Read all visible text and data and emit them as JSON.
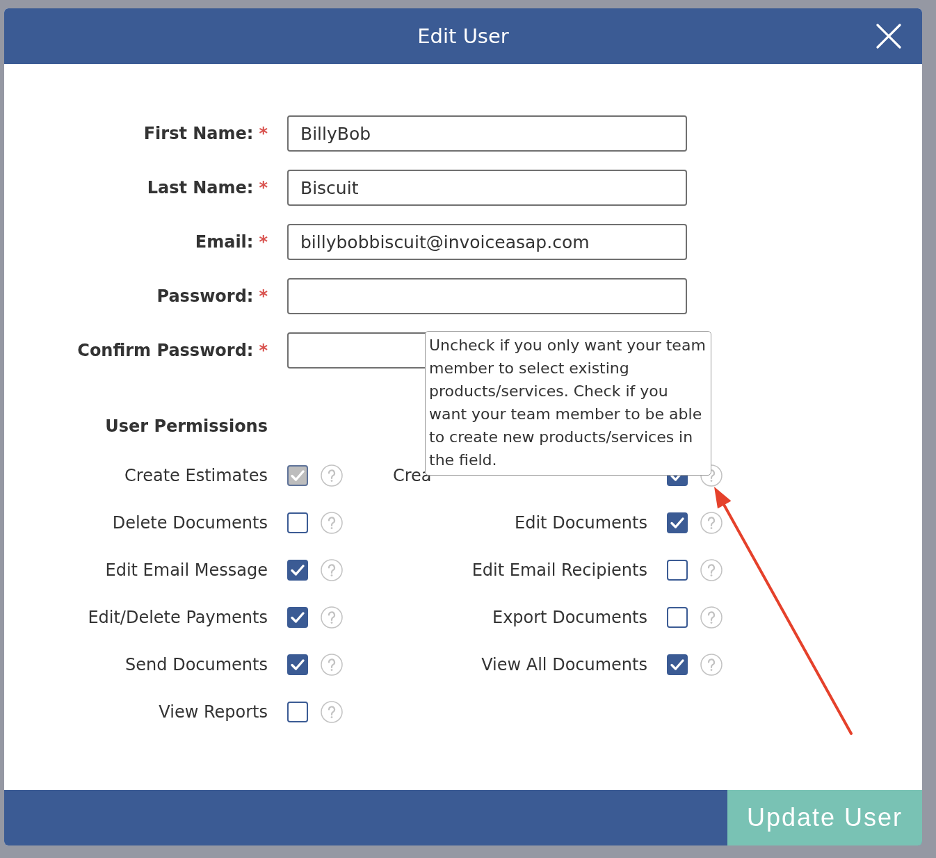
{
  "dialog": {
    "title": "Edit User"
  },
  "fields": [
    {
      "label": "First Name:",
      "asterisk": "*",
      "value": "BillyBob"
    },
    {
      "label": "Last Name:",
      "asterisk": "*",
      "value": "Biscuit"
    },
    {
      "label": "Email:",
      "asterisk": "*",
      "value": "billybobbiscuit@invoiceasap.com"
    },
    {
      "label": "Password:",
      "asterisk": "*"
    },
    {
      "label": "Confirm Password:",
      "asterisk": "*"
    }
  ],
  "permissions": {
    "title": "User Permissions",
    "left": [
      {
        "label": "Create Estimates",
        "checked": true,
        "disabled": true
      },
      {
        "label": "Delete Documents",
        "checked": false,
        "disabled": false
      },
      {
        "label": "Edit Email Message",
        "checked": true,
        "disabled": false
      },
      {
        "label": "Edit/Delete Payments",
        "checked": true,
        "disabled": false
      },
      {
        "label": "Send Documents",
        "checked": true,
        "disabled": false
      },
      {
        "label": "View Reports",
        "checked": false,
        "disabled": false
      }
    ],
    "right": [
      {
        "label": "Crea",
        "checked": true,
        "disabled": false,
        "tooltip": "Uncheck if you only want your team member to select existing products/services. Check if you want your team member to be able to create new products/services in the field."
      },
      {
        "label": "Edit Documents",
        "checked": true,
        "disabled": false
      },
      {
        "label": "Edit Email Recipients",
        "checked": false,
        "disabled": false
      },
      {
        "label": "Export Documents",
        "checked": false,
        "disabled": false
      },
      {
        "label": "View All Documents",
        "checked": true,
        "disabled": false
      }
    ]
  },
  "footer": {
    "button": "Update User"
  }
}
